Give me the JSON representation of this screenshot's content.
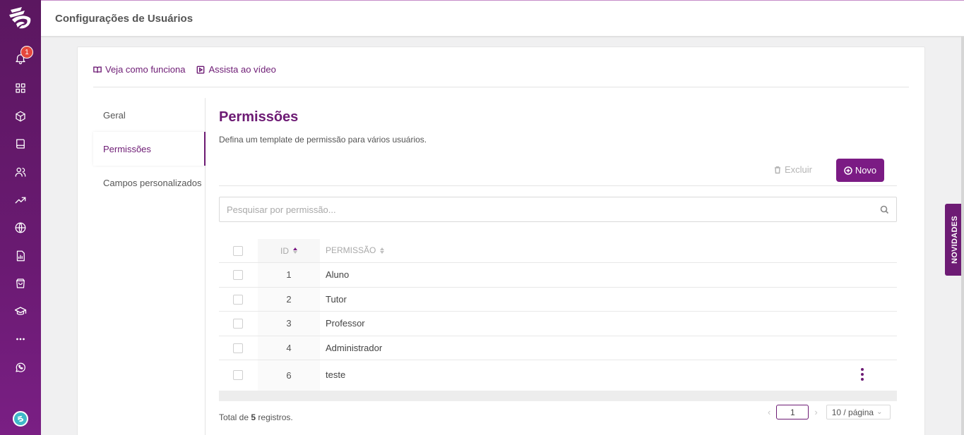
{
  "header": {
    "title": "Configurações de Usuários"
  },
  "sidebar": {
    "notification_count": "1",
    "icons": [
      "bell-icon",
      "grid-icon",
      "cube-icon",
      "book-icon",
      "users-icon",
      "trending-icon",
      "globe-icon",
      "report-icon",
      "shopping-bag-icon",
      "graduation-cap-icon",
      "more-icon",
      "whatsapp-icon"
    ]
  },
  "help_links": {
    "how_it_works": "Veja como funciona",
    "watch_video": "Assista ao vídeo"
  },
  "left_menu": {
    "items": [
      {
        "label": "Geral"
      },
      {
        "label": "Permissões"
      },
      {
        "label": "Campos personalizados"
      }
    ]
  },
  "main": {
    "title": "Permissões",
    "subtitle": "Defina um template de permissão para vários usuários.",
    "delete_label": "Excluir",
    "new_label": "Novo",
    "search_placeholder": "Pesquisar por permissão...",
    "table": {
      "columns": {
        "id": "ID",
        "permission": "PERMISSÃO"
      },
      "rows": [
        {
          "id": "1",
          "permission": "Aluno"
        },
        {
          "id": "2",
          "permission": "Tutor"
        },
        {
          "id": "3",
          "permission": "Professor"
        },
        {
          "id": "4",
          "permission": "Administrador"
        },
        {
          "id": "6",
          "permission": "teste"
        }
      ]
    },
    "total_prefix": "Total de",
    "total_count": "5",
    "total_suffix": "registros.",
    "pagination": {
      "current_page": "1",
      "page_size": "10 / página"
    }
  },
  "novidades_label": "NOVIDADES",
  "colors": {
    "brand": "#6d1b74",
    "button": "#7b1b84",
    "badge": "#e5473c"
  }
}
